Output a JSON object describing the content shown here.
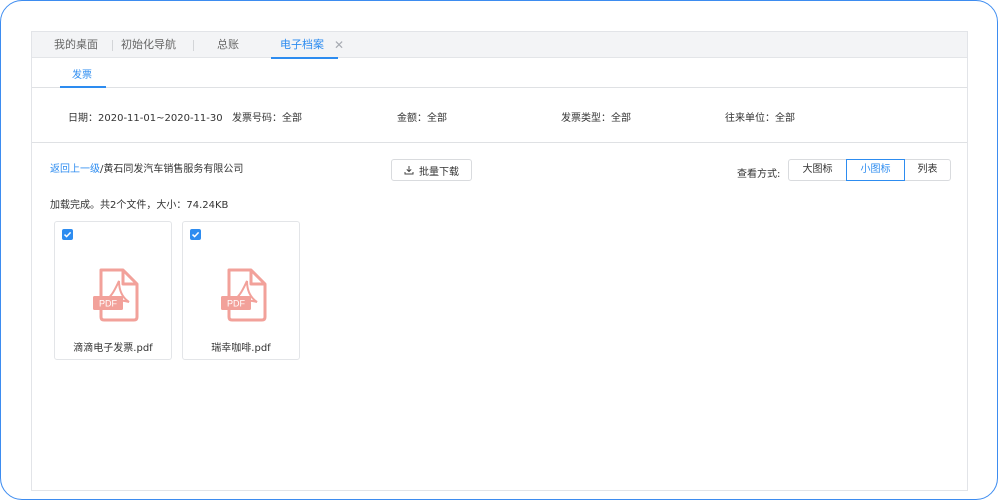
{
  "tabs": [
    {
      "label": "我的桌面",
      "active": false
    },
    {
      "label": "初始化导航",
      "active": false
    },
    {
      "label": "总账",
      "active": false
    },
    {
      "label": "电子档案",
      "active": true,
      "closable": true
    }
  ],
  "close_glyph": "✕",
  "subtab": {
    "label": "发票"
  },
  "filters": [
    {
      "label": "日期：",
      "value": "2020-11-01~2020-11-30"
    },
    {
      "label": "发票号码：",
      "value": "全部"
    },
    {
      "label": "金额：",
      "value": "全部"
    },
    {
      "label": "发票类型：",
      "value": "全部"
    },
    {
      "label": "往来单位：",
      "value": "全部"
    }
  ],
  "breadcrumb": {
    "back_label": "返回上一级",
    "separator": "/",
    "current": "黄石同发汽车销售服务有限公司"
  },
  "toolbar": {
    "download_label": "批量下载",
    "view_mode_label": "查看方式:"
  },
  "view_modes": [
    {
      "label": "大图标",
      "active": false
    },
    {
      "label": "小图标",
      "active": true
    },
    {
      "label": "列表",
      "active": false
    }
  ],
  "status_text": "加载完成。共2个文件，大小：74.24KB",
  "files": [
    {
      "name": "滴滴电子发票.pdf",
      "checked": true,
      "icon": "pdf-file-icon",
      "icon_text": "PDF"
    },
    {
      "name": "瑞幸咖啡.pdf",
      "checked": true,
      "icon": "pdf-file-icon",
      "icon_text": "PDF"
    }
  ],
  "colors": {
    "accent": "#2d8cf0",
    "pdf": "#f2a19a",
    "frame": "#3d8cf0"
  }
}
